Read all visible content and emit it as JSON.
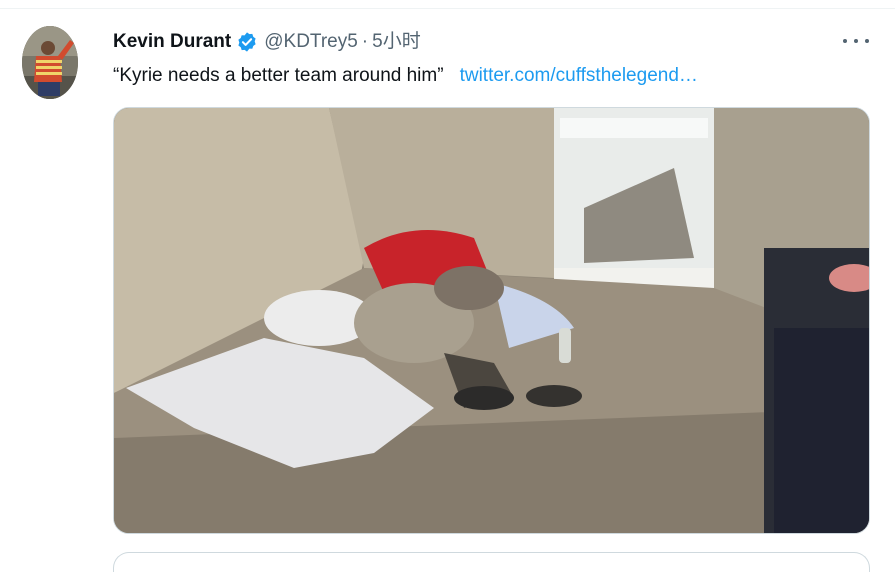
{
  "tweet": {
    "display_name": "Kevin Durant",
    "handle": "@KDTrey5",
    "separator": "·",
    "time": "5小时",
    "text": "“Kyrie needs a better team around him”",
    "link": "twitter.com/cuffsthelegend…",
    "verified_icon": "verified-badge-icon",
    "more_icon": "more-horizontal-icon"
  },
  "colors": {
    "link": "#1d9bf0",
    "secondary_text": "#536471",
    "verified": "#1d9bf0",
    "border": "#cfd9de"
  }
}
